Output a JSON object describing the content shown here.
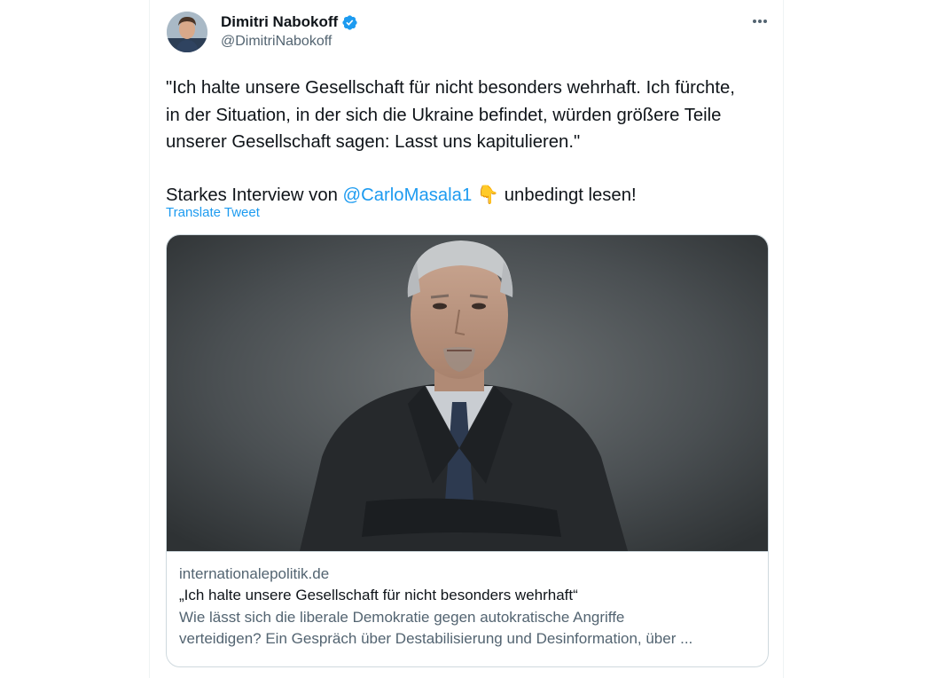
{
  "author": {
    "display_name": "Dimitri Nabokoff",
    "handle": "@DimitriNabokoff",
    "verified": true,
    "avatar": "profile-photo"
  },
  "tweet": {
    "text_line1": "\"Ich halte unsere Gesellschaft für nicht besonders wehrhaft. Ich fürchte,",
    "text_line2": "in der Situation, in der sich die Ukraine befindet, würden größere Teile",
    "text_line3": "unserer Gesellschaft sagen: Lasst uns kapitulieren.\"",
    "line4_prefix": "Starkes Interview von ",
    "mention": "@CarloMasala1",
    "emoji": "👇",
    "line4_suffix": " unbedingt lesen!",
    "translate_label": "Translate Tweet"
  },
  "link_card": {
    "image": "portrait-photo",
    "domain": "internationalepolitik.de",
    "title": "„Ich halte unsere Gesellschaft für nicht besonders wehrhaft“",
    "description_line1": "Wie lässt sich die liberale Demokratie gegen autokratische Angriffe",
    "description_line2": "verteidigen? Ein Gespräch über Destabilisierung und Desinformation, über ..."
  },
  "icons": {
    "verified": "verified-badge-icon",
    "more": "more-options-icon"
  },
  "colors": {
    "accent": "#1d9bf0",
    "text": "#0f1419",
    "secondary": "#536471",
    "border": "#cfd9de"
  }
}
